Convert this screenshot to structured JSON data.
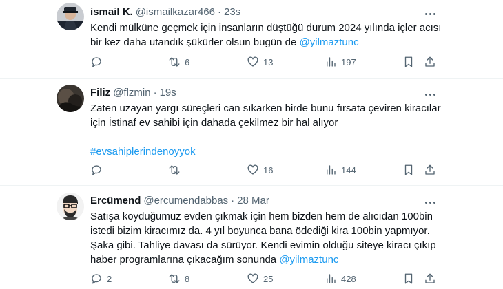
{
  "tweets": [
    {
      "name": "ismail K.",
      "handle": "@ismailkazar466",
      "dot": "·",
      "time": "23s",
      "text_a": "Kendi mülküne geçmek için insanların düştüğü durum 2024 yılında içler acısı bir kez daha utandık şükürler olsun bugün de ",
      "mention": "@yilmaztunc",
      "replies": "",
      "retweets": "6",
      "likes": "13",
      "views": "197"
    },
    {
      "name": "Filiz",
      "handle": "@flzmin",
      "dot": "·",
      "time": "19s",
      "text_a": "Zaten uzayan yargı süreçleri can sıkarken birde bunu fırsata çeviren kiracılar için İstinaf ev sahibi için dahada çekilmez bir hal alıyor",
      "hashtag": "#evsahiplerindenoyyok",
      "replies": "",
      "retweets": "",
      "likes": "16",
      "views": "144"
    },
    {
      "name": "Ercümend",
      "handle": "@ercumendabbas",
      "dot": "·",
      "time": "28 Mar",
      "text_a": "Satışa koyduğumuz evden çıkmak için hem bizden hem de alıcıdan 100bin istedi bizim kiracımız da. 4 yıl boyunca bana ödediği kira 100bin yapmıyor. Şaka gibi. Tahliye davası da sürüyor. Kendi evimin olduğu siteye kiracı çıkıp haber programlarına çıkacağım sonunda ",
      "mention": "@yilmaztunc",
      "replies": "2",
      "retweets": "8",
      "likes": "25",
      "views": "428"
    }
  ]
}
